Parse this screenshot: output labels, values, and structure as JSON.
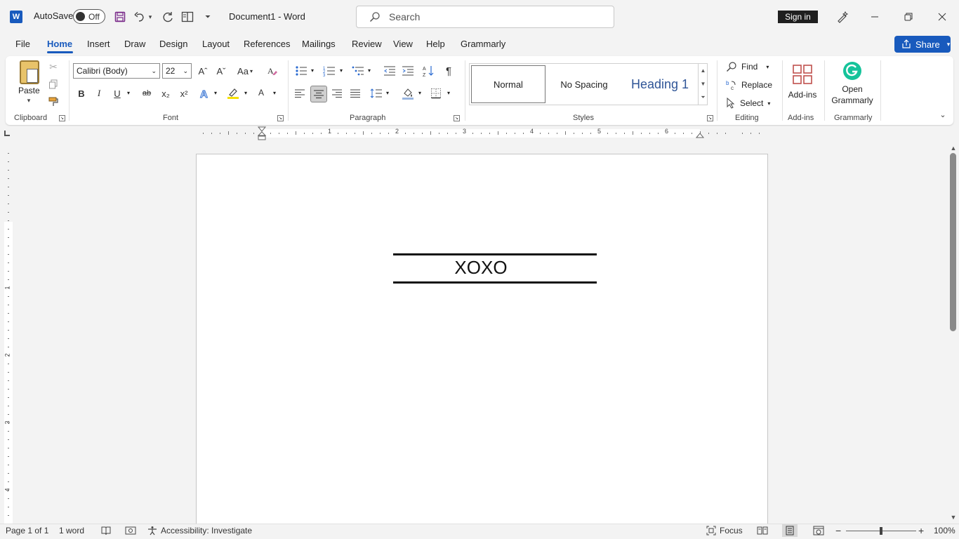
{
  "titlebar": {
    "app_logo": "W",
    "autosave_label": "AutoSave",
    "autosave_state": "Off",
    "doc_title": "Document1  -  Word",
    "search_placeholder": "Search",
    "sign_in": "Sign in",
    "icons": [
      "word-logo-icon",
      "save-icon",
      "undo-icon",
      "redo-icon",
      "layout-icon",
      "customize-qat-icon",
      "designer-icon",
      "minimize-icon",
      "restore-icon",
      "close-icon"
    ]
  },
  "tabs": [
    "File",
    "Home",
    "Insert",
    "Draw",
    "Design",
    "Layout",
    "References",
    "Mailings",
    "Review",
    "View",
    "Help",
    "Grammarly"
  ],
  "active_tab": "Home",
  "share_label": "Share",
  "ribbon": {
    "clipboard": {
      "paste_label": "Paste",
      "group_label": "Clipboard"
    },
    "font": {
      "font_name": "Calibri (Body)",
      "font_size": "22",
      "group_label": "Font",
      "bold": "B",
      "italic": "I",
      "underline": "U",
      "strike": "ab",
      "subscript": "x₂",
      "superscript": "x²",
      "grow": "Aˆ",
      "shrink": "Aˇ",
      "change_case": "Aa",
      "font_color": "A"
    },
    "paragraph": {
      "group_label": "Paragraph",
      "pilcrow": "¶"
    },
    "styles": {
      "group_label": "Styles",
      "items": [
        "Normal",
        "No Spacing",
        "Heading 1"
      ]
    },
    "editing": {
      "group_label": "Editing",
      "find": "Find",
      "replace": "Replace",
      "select": "Select"
    },
    "addins": {
      "label": "Add-ins",
      "group_label": "Add-ins"
    },
    "grammarly": {
      "label_line1": "Open",
      "label_line2": "Grammarly",
      "group_label": "Grammarly"
    }
  },
  "ruler": {
    "h_numbers": [
      "1",
      "2",
      "3",
      "4",
      "5",
      "6"
    ],
    "v_numbers": [
      "1",
      "2",
      "3",
      "4"
    ]
  },
  "document": {
    "text": "XOXO"
  },
  "status": {
    "page": "Page 1 of 1",
    "words": "1 word",
    "accessibility": "Accessibility: Investigate",
    "focus": "Focus",
    "zoom": "100%"
  },
  "colors": {
    "accent": "#185abd",
    "heading_style": "#2f5597"
  }
}
